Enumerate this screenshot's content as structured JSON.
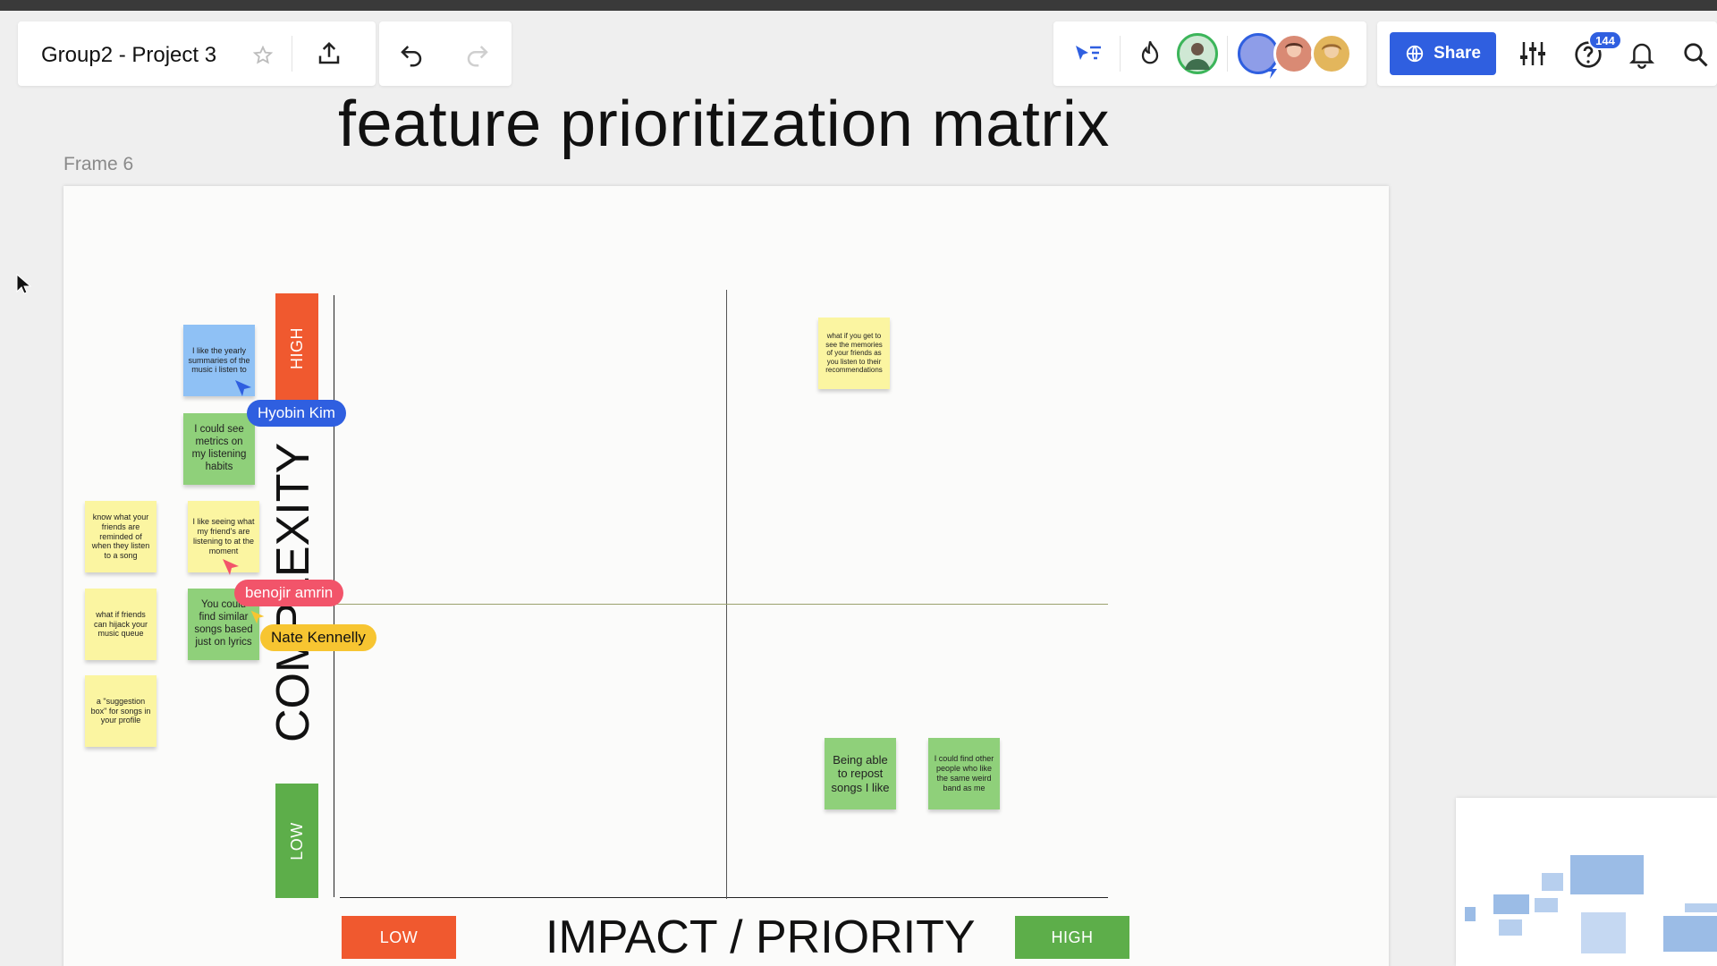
{
  "toolbar": {
    "board_name": "Group2 - Project 3",
    "share_label": "Share",
    "notifications_count": "144",
    "icons": [
      "star-icon",
      "export-icon",
      "undo-icon",
      "redo-icon",
      "select-cursor-icon",
      "fire-icon",
      "sliders-icon",
      "help-icon",
      "bell-icon",
      "search-icon",
      "globe-icon"
    ]
  },
  "canvas": {
    "title": "feature prioritization matrix",
    "frame_label": "Frame 6",
    "x_axis_title": "IMPACT / PRIORITY",
    "y_axis_title": "COMPLEXITY",
    "x_low": "LOW",
    "x_high": "HIGH",
    "y_high": "HIGH",
    "y_low": "LOW"
  },
  "stickies": [
    {
      "text": "I like the yearly summaries of the music i listen to",
      "color": "blue"
    },
    {
      "text": "I could see metrics on my listening habits",
      "color": "green"
    },
    {
      "text": "know what your friends are reminded of when they listen to a song",
      "color": "yellow"
    },
    {
      "text": "I like seeing what my friend's are listening to at the moment",
      "color": "yellow"
    },
    {
      "text": "what if friends can hijack your music queue",
      "color": "yellow"
    },
    {
      "text": "You could find similar songs based just on lyrics",
      "color": "green"
    },
    {
      "text": "a \"suggestion box\" for songs in your profile",
      "color": "yellow"
    },
    {
      "text": "what if you get to see the memories of your friends as you listen to their recommendations",
      "color": "yellow"
    },
    {
      "text": "Being able to repost songs I like",
      "color": "green"
    },
    {
      "text": "I could find other people who like the same weird band as me",
      "color": "green"
    }
  ],
  "collaborators": [
    {
      "name": "Hyobin Kim",
      "color": "#2f5fe0"
    },
    {
      "name": "benojir amrin",
      "color": "#f2546a"
    },
    {
      "name": "Nate Kennelly",
      "color": "#f7c531"
    }
  ],
  "colors": {
    "accent": "#2f5fe0",
    "high_tag": "#f0592f",
    "low_tag": "#5dae4a"
  }
}
